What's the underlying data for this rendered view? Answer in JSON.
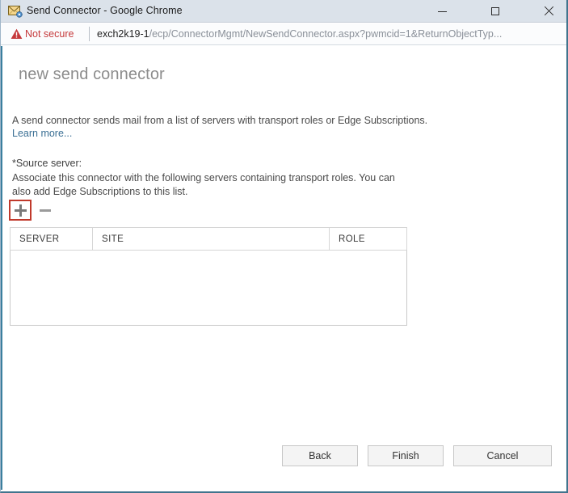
{
  "window": {
    "title": "Send Connector - Google Chrome",
    "favicon": "envelope-gear-icon",
    "minimize_label": "Minimize",
    "maximize_label": "Maximize",
    "close_label": "Close"
  },
  "addressbar": {
    "security_icon": "warning-triangle-icon",
    "security_label": "Not secure",
    "url_host": "exch2k19-1",
    "url_path": "/ecp/ConnectorMgmt/NewSendConnector.aspx?pwmcid=1&ReturnObjectTyp..."
  },
  "page": {
    "title": "new send connector",
    "intro": "A send connector sends mail from a list of servers with transport roles or Edge Subscriptions.",
    "learn_more": "Learn more...",
    "field_label": "*Source server:",
    "field_description": "Associate this connector with the following servers containing transport roles. You can also add Edge Subscriptions to this list.",
    "toolbar": {
      "add_icon": "plus-icon",
      "remove_icon": "minus-icon"
    },
    "table": {
      "columns": [
        "SERVER",
        "SITE",
        "ROLE"
      ],
      "rows": []
    },
    "footer": {
      "back_label": "Back",
      "finish_label": "Finish",
      "cancel_label": "Cancel"
    }
  },
  "colors": {
    "accent_stripe": "#3b7f9e",
    "highlight_box": "#c0392b",
    "link": "#3a6f94",
    "not_secure": "#c5393b",
    "titlebar": "#dbe2ea"
  }
}
